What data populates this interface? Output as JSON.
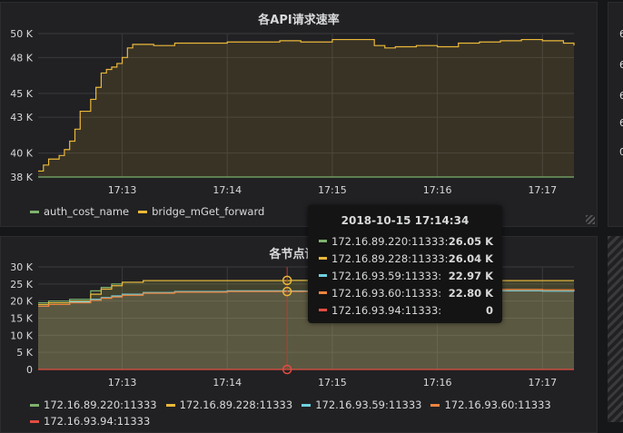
{
  "panels": {
    "top": {
      "title": "各API请求速率",
      "legend": [
        {
          "name": "auth_cost_name",
          "color": "#7eb26d"
        },
        {
          "name": "bridge_mGet_forward",
          "color": "#eab839"
        }
      ]
    },
    "bottom": {
      "title": "各节点请求",
      "legend": [
        {
          "name": "172.16.89.220:11333",
          "color": "#7eb26d"
        },
        {
          "name": "172.16.89.228:11333",
          "color": "#eab839"
        },
        {
          "name": "172.16.93.59:11333",
          "color": "#6ed0e0"
        },
        {
          "name": "172.16.93.60:11333",
          "color": "#ef843c"
        },
        {
          "name": "172.16.93.94:11333",
          "color": "#e24d42"
        }
      ]
    }
  },
  "tooltip": {
    "time": "2018-10-15 17:14:34",
    "rows": [
      {
        "name": "172.16.89.220:11333:",
        "value": "26.05 K",
        "color": "#7eb26d"
      },
      {
        "name": "172.16.89.228:11333:",
        "value": "26.04 K",
        "color": "#eab839"
      },
      {
        "name": "172.16.93.59:11333:",
        "value": "22.97 K",
        "color": "#6ed0e0"
      },
      {
        "name": "172.16.93.60:11333:",
        "value": "22.80 K",
        "color": "#ef843c"
      },
      {
        "name": "172.16.93.94:11333:",
        "value": "0",
        "color": "#e24d42"
      }
    ]
  },
  "side_labels": [
    "6",
    "6",
    "6",
    "6",
    "0"
  ],
  "chart_data": [
    {
      "type": "area",
      "title": "各API请求速率",
      "xlabel": "",
      "ylabel": "",
      "x_ticks": [
        "17:13",
        "17:14",
        "17:15",
        "17:16",
        "17:17"
      ],
      "y_ticks": [
        "38 K",
        "40 K",
        "43 K",
        "45 K",
        "48 K",
        "50 K"
      ],
      "ylim": [
        38000,
        50000
      ],
      "x_minutes": [
        12.2,
        12.25,
        12.3,
        12.4,
        12.45,
        12.5,
        12.55,
        12.6,
        12.65,
        12.7,
        12.75,
        12.8,
        12.85,
        12.9,
        12.95,
        13.0,
        13.05,
        13.1,
        13.2,
        13.3,
        13.5,
        13.7,
        14.0,
        14.3,
        14.5,
        14.7,
        15.0,
        15.2,
        15.4,
        15.5,
        15.6,
        15.8,
        16.0,
        16.2,
        16.4,
        16.6,
        16.8,
        17.0,
        17.2,
        17.3
      ],
      "series": [
        {
          "name": "bridge_mGet_forward",
          "color": "#eab839",
          "values": [
            38500,
            39000,
            39500,
            39800,
            40300,
            41000,
            42000,
            43500,
            43500,
            44500,
            45500,
            46700,
            47000,
            47200,
            47500,
            48000,
            48800,
            49100,
            49100,
            49000,
            49200,
            49200,
            49300,
            49300,
            49400,
            49300,
            49500,
            49500,
            49000,
            48800,
            48900,
            49000,
            48900,
            49200,
            49300,
            49400,
            49500,
            49400,
            49200,
            49000
          ]
        },
        {
          "name": "auth_cost_name",
          "color": "#7eb26d",
          "values": [
            38000,
            38000,
            38000,
            38000,
            38000,
            38000,
            38000,
            38000,
            38000,
            38000,
            38000,
            38000,
            38000,
            38000,
            38000,
            38000,
            38000,
            38000,
            38000,
            38000,
            38000,
            38000,
            38000,
            38000,
            38000,
            38000,
            38000,
            38000,
            38000,
            38000,
            38000,
            38000,
            38000,
            38000,
            38000,
            38000,
            38000,
            38000,
            38000,
            38000
          ]
        }
      ]
    },
    {
      "type": "area",
      "title": "各节点请求",
      "xlabel": "",
      "ylabel": "",
      "x_ticks": [
        "17:13",
        "17:14",
        "17:15",
        "17:16",
        "17:17"
      ],
      "y_ticks": [
        "0",
        "5 K",
        "10 K",
        "15 K",
        "20 K",
        "25 K",
        "30 K"
      ],
      "ylim": [
        0,
        30000
      ],
      "x_minutes": [
        12.2,
        12.3,
        12.5,
        12.7,
        12.8,
        12.9,
        13.0,
        13.2,
        13.5,
        14.0,
        14.3,
        14.6,
        15.0,
        15.5,
        16.0,
        16.5,
        17.0,
        17.3
      ],
      "series": [
        {
          "name": "172.16.89.220:11333",
          "color": "#7eb26d",
          "values": [
            19500,
            20000,
            20500,
            23000,
            24000,
            25000,
            25500,
            26000,
            26000,
            26000,
            26000,
            26050,
            26000,
            26000,
            26000,
            26000,
            26000,
            26000
          ]
        },
        {
          "name": "172.16.89.228:11333",
          "color": "#eab839",
          "values": [
            19000,
            19500,
            20000,
            22000,
            23500,
            24500,
            25500,
            26000,
            26000,
            26000,
            26000,
            26040,
            26000,
            26100,
            26000,
            26000,
            26000,
            26000
          ]
        },
        {
          "name": "172.16.93.59:11333",
          "color": "#6ed0e0",
          "values": [
            18500,
            19000,
            19800,
            20500,
            21000,
            21500,
            22000,
            22500,
            22800,
            23000,
            23000,
            22970,
            23000,
            23100,
            23000,
            23000,
            22900,
            22800
          ]
        },
        {
          "name": "172.16.93.60:11333",
          "color": "#ef843c",
          "values": [
            18500,
            19000,
            19500,
            20200,
            20800,
            21200,
            21700,
            22300,
            22600,
            22800,
            22800,
            22800,
            22900,
            23500,
            23000,
            23400,
            23300,
            23000
          ]
        },
        {
          "name": "172.16.93.94:11333",
          "color": "#e24d42",
          "values": [
            0,
            0,
            0,
            0,
            0,
            0,
            0,
            0,
            0,
            0,
            0,
            0,
            0,
            0,
            0,
            0,
            0,
            0
          ]
        }
      ]
    }
  ]
}
